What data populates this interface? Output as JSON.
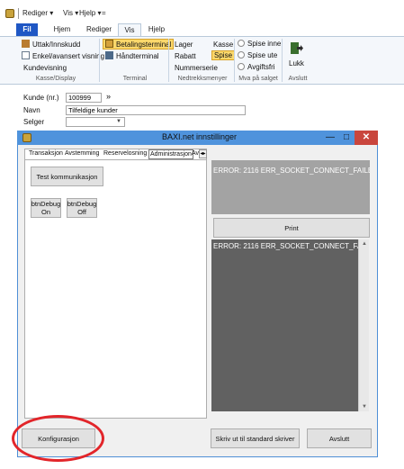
{
  "titlebar": {
    "qat": [
      "Rediger ▾",
      "Vis ▾",
      "Hjelp ▾",
      "="
    ]
  },
  "ribbon_tabs": [
    "Fil",
    "Hjem",
    "Rediger",
    "Vis",
    "Hjelp"
  ],
  "ribbon": {
    "kasse_display": {
      "items": [
        "Uttak/Innskudd",
        "Enkel/avansert visning",
        "Kundevisning"
      ],
      "label": "Kasse/Display"
    },
    "terminal": {
      "items": [
        "Betalingsterminal",
        "Håndterminal"
      ],
      "label": "Terminal"
    },
    "nedtrekksmenyer": {
      "items": [
        "Lager",
        "Kasse",
        "Rabatt",
        "Spise",
        "Nummerserie"
      ],
      "label": "Nedtrekksmenyer"
    },
    "mva": {
      "items": [
        "Spise inne",
        "Spise ute",
        "Avgiftsfri"
      ],
      "label": "Mva på salget"
    },
    "avslutt": {
      "items": [
        "Lukk"
      ],
      "label": "Avslutt"
    }
  },
  "form": {
    "kunde_label": "Kunde (nr.)",
    "kunde_value": "100999",
    "kunde_arrow": "»",
    "navn_label": "Navn",
    "navn_value": "Tilfeldige kunder",
    "selger_label": "Selger",
    "selger_value": ""
  },
  "dialog": {
    "title": "BAXI.net innstillinger",
    "window_buttons": [
      "—",
      "□",
      "✕"
    ],
    "tabs": [
      "Transaksjon",
      "Avstemming",
      "Reservelosning",
      "Administrasjon",
      "Av"
    ],
    "active_tab": "Administrasjon",
    "tab_scroll_glyph": "◂▸",
    "admin": {
      "test_button": "Test kommunikasjon",
      "debug_on": [
        "btnDebug",
        "On"
      ],
      "debug_off": [
        "btnDebug",
        "Off"
      ]
    },
    "error_box_1": "ERROR: 2116 ERR_SOCKET_CONNECT_FAILED",
    "print_button": "Print",
    "error_box_2": "ERROR: 2116 ERR_SOCKET_CONNECT_FAILED",
    "scroll_up": "▲",
    "scroll_down": "▼",
    "bottom_buttons": {
      "konfigurasjon": "Konfigurasjon",
      "skriv_ut": "Skriv ut til standard skriver",
      "avslutt": "Avslutt"
    }
  },
  "colors": {
    "file_tab": "#1f57c4",
    "dialog_title": "#4f93dc",
    "close_button": "#c9463d",
    "highlight": "#fbd86b",
    "annotation": "#e2252a",
    "error_light": "#a3a3a3",
    "error_dark": "#616161"
  }
}
